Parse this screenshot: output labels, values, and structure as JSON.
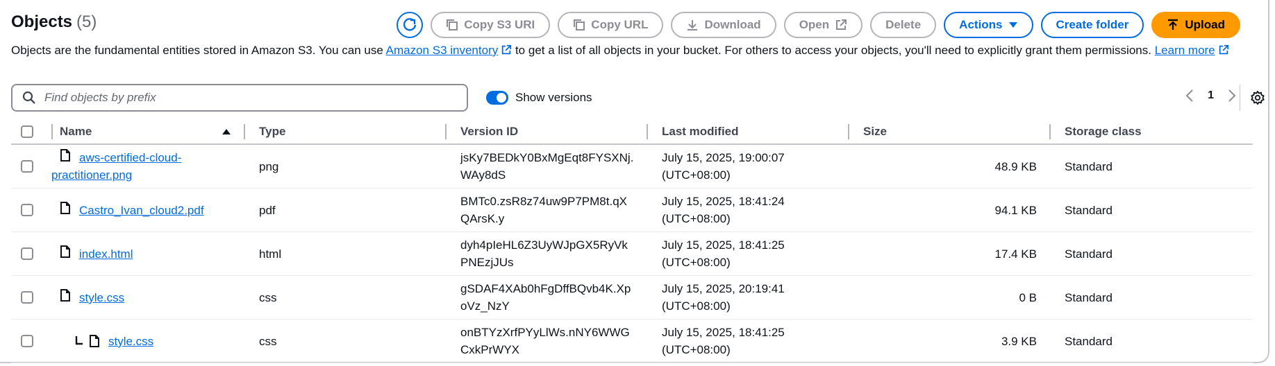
{
  "header": {
    "title": "Objects",
    "count": "(5)"
  },
  "toolbar": {
    "copy_s3_uri": "Copy S3 URI",
    "copy_url": "Copy URL",
    "download": "Download",
    "open": "Open",
    "delete": "Delete",
    "actions": "Actions",
    "create_folder": "Create folder",
    "upload": "Upload"
  },
  "description": {
    "text_1": "Objects are the fundamental entities stored in Amazon S3. You can use ",
    "link_1": "Amazon S3 inventory",
    "text_2": " to get a list of all objects in your bucket. For others to access your objects, you'll need to explicitly grant them permissions. ",
    "link_2": "Learn more"
  },
  "search": {
    "placeholder": "Find objects by prefix",
    "value": ""
  },
  "versions_toggle": {
    "label": "Show versions",
    "on": true
  },
  "pagination": {
    "current_page": "1"
  },
  "table": {
    "columns": {
      "name": "Name",
      "type": "Type",
      "version_id": "Version ID",
      "last_modified": "Last modified",
      "size": "Size",
      "storage_class": "Storage class"
    },
    "rows": [
      {
        "name_line1": "aws-certified-cloud-",
        "name_line2": "practitioner.png",
        "type": "png",
        "version_line1": "jsKy7BEDkY0BxMgEqt8FYSXNj.",
        "version_line2": "WAy8dS",
        "modified_line1": "July 15, 2025, 19:00:07",
        "modified_line2": "(UTC+08:00)",
        "size": "48.9 KB",
        "storage_class": "Standard"
      },
      {
        "name_line1": "Castro_Ivan_cloud2.pdf",
        "name_line2": "",
        "type": "pdf",
        "version_line1": "BMTc0.zsR8z74uw9P7PM8t.qX",
        "version_line2": "QArsK.y",
        "modified_line1": "July 15, 2025, 18:41:24",
        "modified_line2": "(UTC+08:00)",
        "size": "94.1 KB",
        "storage_class": "Standard"
      },
      {
        "name_line1": "index.html",
        "name_line2": "",
        "type": "html",
        "version_line1": "dyh4pIeHL6Z3UyWJpGX5RyVk",
        "version_line2": "PNEzjJUs",
        "modified_line1": "July 15, 2025, 18:41:25",
        "modified_line2": "(UTC+08:00)",
        "size": "17.4 KB",
        "storage_class": "Standard"
      },
      {
        "name_line1": "style.css",
        "name_line2": "",
        "type": "css",
        "version_line1": "gSDAF4XAb0hFgDffBQvb4K.Xp",
        "version_line2": "oVz_NzY",
        "modified_line1": "July 15, 2025, 20:19:41",
        "modified_line2": "(UTC+08:00)",
        "size": "0 B",
        "storage_class": "Standard"
      },
      {
        "name_line1": "style.css",
        "name_line2": "",
        "type": "css",
        "version_line1": "onBTYzXrfPYyLlWs.nNY6WWG",
        "version_line2": "CxkPrWYX",
        "modified_line1": "July 15, 2025, 18:41:25",
        "modified_line2": "(UTC+08:00)",
        "size": "3.9 KB",
        "storage_class": "Standard"
      }
    ]
  },
  "colors": {
    "link": "#006ce0",
    "primary_button": "#ff9900",
    "disabled": "#8c8c94"
  }
}
